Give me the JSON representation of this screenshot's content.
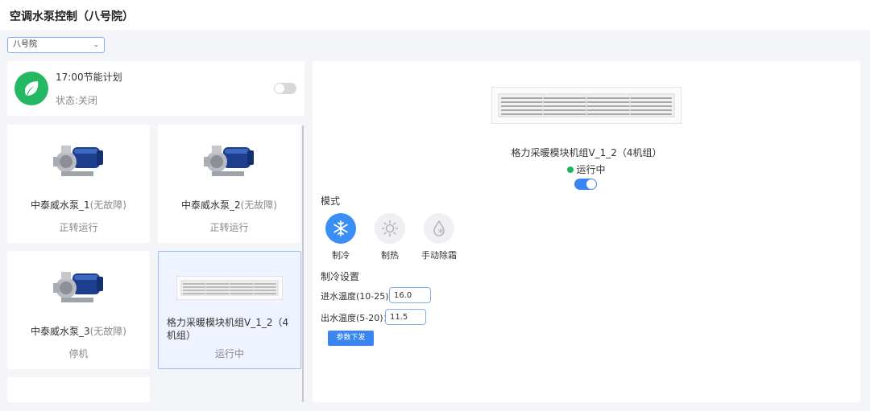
{
  "page": {
    "title": "空调水泵控制（八号院）"
  },
  "campus_select": {
    "value": "八号院"
  },
  "plan": {
    "title": "17:00节能计划",
    "status": "状态:关闭",
    "enabled": false
  },
  "devices": [
    {
      "name": "中泰威水泵_1",
      "fault": "(无故障)",
      "state": "正转运行"
    },
    {
      "name": "中泰威水泵_2",
      "fault": "(无故障)",
      "state": "正转运行"
    },
    {
      "name": "中泰威水泵_3",
      "fault": "(无故障)",
      "state": "停机"
    },
    {
      "name": "格力采暖模块机组V_1_2（4机组）",
      "state": "运行中",
      "selected": true
    }
  ],
  "detail": {
    "name": "格力采暖模块机组V_1_2（4机组）",
    "status": "运行中",
    "power_on": true,
    "mode_title": "模式",
    "modes": [
      {
        "label": "制冷",
        "icon": "snowflake-icon",
        "active": true
      },
      {
        "label": "制热",
        "icon": "sun-icon",
        "active": false
      },
      {
        "label": "手动除霜",
        "icon": "defrost-drop-icon",
        "active": false
      }
    ],
    "settings_title": "制冷设置",
    "inlet_label": "进水温度(10-25)：",
    "inlet_value": "16.0",
    "outlet_label": "出水温度(5-20)：",
    "outlet_value": "11.5",
    "submit_label": "参数下发"
  },
  "colors": {
    "accent": "#3a86f0",
    "running": "#1bb55c",
    "leaf": "#25b862"
  }
}
